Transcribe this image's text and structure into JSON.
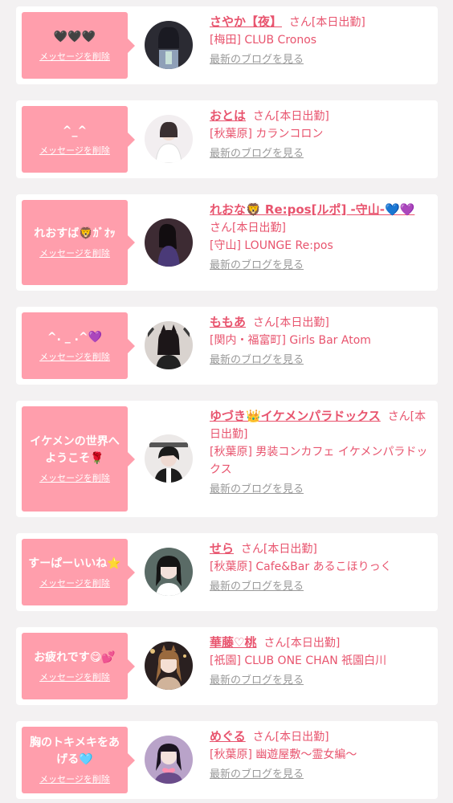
{
  "entries": [
    {
      "message": "🖤🖤🖤",
      "delete_label": "メッセージを削除",
      "name": "さやか【夜】",
      "honorific": "さん[本日出勤]",
      "shop": "[梅田] CLUB Cronos",
      "blog_label": "最新のブログを見る"
    },
    {
      "message": "^_^",
      "delete_label": "メッセージを削除",
      "name": "おとは",
      "honorific": "さん[本日出勤]",
      "shop": "[秋葉原] カランコロン",
      "blog_label": "最新のブログを見る"
    },
    {
      "message": "れおすば🦁ｶﾞｵｯ",
      "delete_label": "メッセージを削除",
      "name": "れおな🦁 Re:pos[ルポ] -守山-💙💜",
      "honorific": "さん[本日出勤]",
      "shop": "[守山] LOUNGE Re:pos",
      "blog_label": "最新のブログを見る"
    },
    {
      "message": "^. _ .^💜",
      "delete_label": "メッセージを削除",
      "name": "ももあ",
      "honorific": "さん[本日出勤]",
      "shop": "[関内・福富町] Girls Bar Atom",
      "blog_label": "最新のブログを見る"
    },
    {
      "message": "イケメンの世界へようこそ🌹",
      "delete_label": "メッセージを削除",
      "name": "ゆづき👑イケメンパラドックス",
      "honorific": "さん[本日出勤]",
      "shop": "[秋葉原] 男装コンカフェ イケメンパラドックス",
      "blog_label": "最新のブログを見る"
    },
    {
      "message": "すーぱーいいね⭐",
      "delete_label": "メッセージを削除",
      "name": "せら",
      "honorific": "さん[本日出勤]",
      "shop": "[秋葉原] Cafe&Bar あるこほりっく",
      "blog_label": "最新のブログを見る"
    },
    {
      "message": "お疲れです😋💕",
      "delete_label": "メッセージを削除",
      "name": "華藤♡桃",
      "honorific": "さん[本日出勤]",
      "shop": "[祇園] CLUB ONE CHAN 祇園白川",
      "blog_label": "最新のブログを見る"
    },
    {
      "message": "胸のトキメキをあげる🩵",
      "delete_label": "メッセージを削除",
      "name": "めぐる",
      "honorific": "さん[本日出勤]",
      "shop": "[秋葉原] 幽遊屋敷〜霊女編〜",
      "blog_label": "最新のブログを見る"
    }
  ],
  "colors": {
    "background": "#f3f1f2",
    "card": "#ffffff",
    "bubble": "#ff9eac",
    "accent_text": "#e8546e",
    "muted_text": "#999999"
  }
}
